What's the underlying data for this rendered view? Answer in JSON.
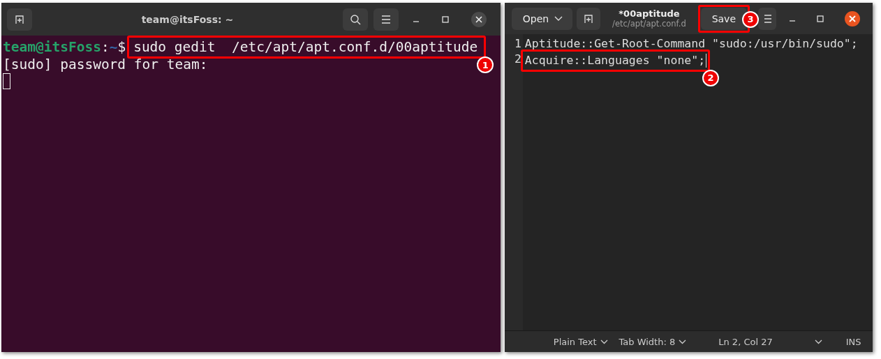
{
  "terminal": {
    "title": "team@itsFoss: ~",
    "prompt_user": "team@itsFoss",
    "prompt_sep": ":",
    "prompt_path": "~",
    "prompt_symbol": "$",
    "command": "sudo gedit  /etc/apt/apt.conf.d/00aptitude",
    "command_callout": "1",
    "output": "[sudo] password for team:"
  },
  "editor": {
    "open_label": "Open",
    "title": "*00aptitude",
    "subtitle": "/etc/apt/apt.conf.d",
    "save_label": "Save",
    "save_callout": "3",
    "lines": [
      {
        "number": "1",
        "text": "Aptitude::Get-Root-Command \"sudo:/usr/bin/sudo\";"
      },
      {
        "number": "2",
        "text": "Acquire::Languages \"none\";",
        "callout": "2"
      }
    ],
    "status_bar": {
      "language": "Plain Text",
      "tab_width": "Tab Width: 8",
      "position": "Ln 2, Col 27",
      "mode": "INS"
    }
  }
}
